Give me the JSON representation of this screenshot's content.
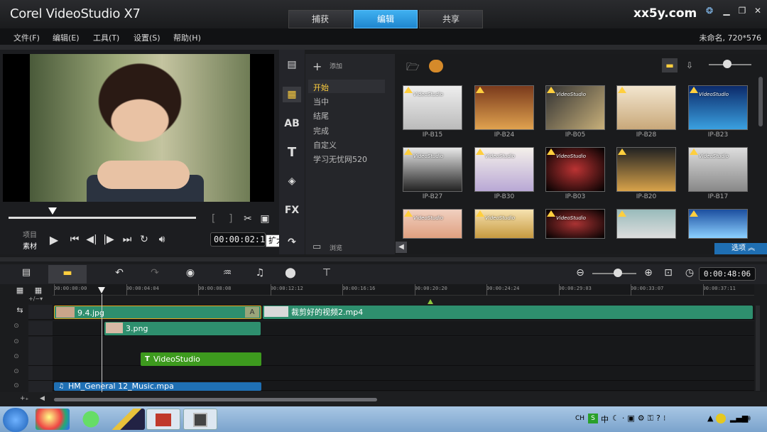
{
  "app_title": "Corel VideoStudio X7",
  "mode_tabs": [
    "捕获",
    "编辑",
    "共享"
  ],
  "brand": "xx5y.com",
  "menu": [
    "文件(F)",
    "编辑(E)",
    "工具(T)",
    "设置(S)",
    "帮助(H)"
  ],
  "project_info": "未命名, 720*576",
  "preview": {
    "mode_project": "项目",
    "mode_clip": "素材",
    "timecode": "00:00:02:19",
    "tooltip": "扩大"
  },
  "library": {
    "add_label": "添加",
    "browse_label": "浏览",
    "options_label": "选项",
    "categories": [
      "开始",
      "当中",
      "结尾",
      "完成",
      "自定义",
      "学习无忧网520"
    ],
    "templates": [
      {
        "id": "IP-B15",
        "caption": "VideoStudio"
      },
      {
        "id": "IP-B24",
        "caption": ""
      },
      {
        "id": "IP-B05",
        "caption": "VideoStudio"
      },
      {
        "id": "IP-B28",
        "caption": ""
      },
      {
        "id": "IP-B23",
        "caption": "VideoStudio"
      },
      {
        "id": "IP-B27",
        "caption": "VideoStudio"
      },
      {
        "id": "IP-B30",
        "caption": "VideoStudio"
      },
      {
        "id": "IP-B03",
        "caption": "VideoStudio"
      },
      {
        "id": "IP-B20",
        "caption": ""
      },
      {
        "id": "IP-B17",
        "caption": "VideoStudio"
      },
      {
        "id": "",
        "caption": "VideoStudio"
      },
      {
        "id": "",
        "caption": "VideoStudio"
      },
      {
        "id": "",
        "caption": "VideoStudio"
      },
      {
        "id": "",
        "caption": ""
      },
      {
        "id": "",
        "caption": ""
      }
    ],
    "sidebar_icons": [
      "media-icon",
      "instant-project-icon",
      "transition-icon",
      "title-icon",
      "graphic-icon",
      "filter-icon"
    ],
    "sidebar_fx": "FX"
  },
  "timeline": {
    "duration": "0:00:48:06",
    "ruler": [
      "00:00:00:00",
      "00:00:04:04",
      "00:00:08:08",
      "00:00:12:12",
      "00:00:16:16",
      "00:00:20:20",
      "00:00:24:24",
      "00:00:29:03",
      "00:00:33:07",
      "00:00:37:11"
    ],
    "clips": {
      "video1": "9.4.jpg",
      "video2": "裁剪好的视频2.mp4",
      "overlay": "3.png",
      "title": "VideoStudio",
      "title_marker": "T",
      "music": "HM_General 12_Music.mpa",
      "music_marker": "♫",
      "transition": "A"
    }
  },
  "taskbar": {
    "tray": [
      "CH",
      "S",
      "中"
    ]
  }
}
